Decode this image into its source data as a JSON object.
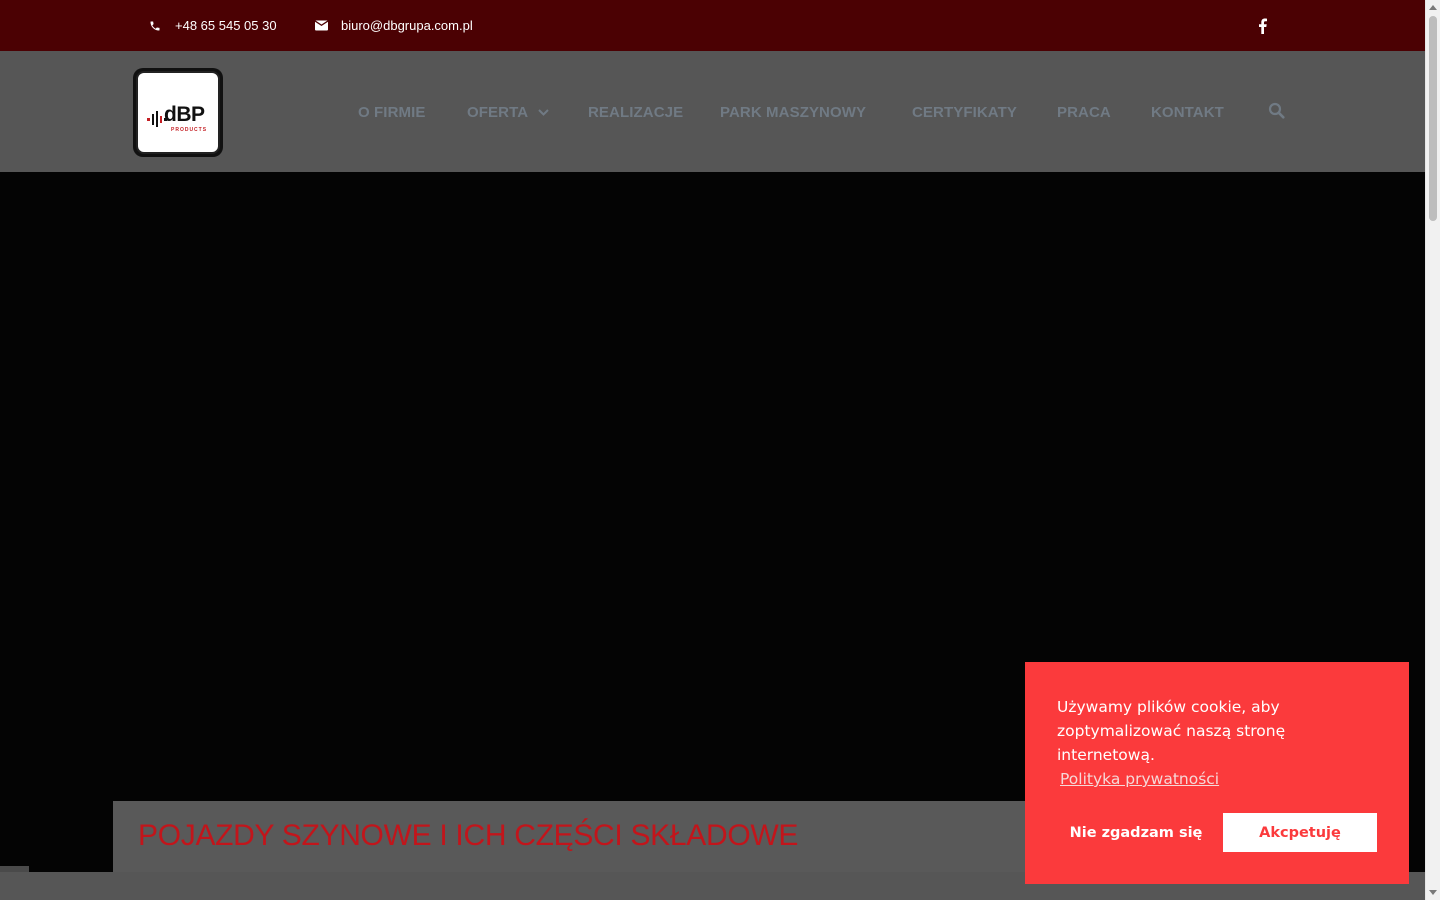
{
  "topbar": {
    "phone": "+48 65 545 05 30",
    "email": "biuro@dbgrupa.com.pl",
    "phone_icon": "phone-icon",
    "email_icon": "envelope-icon",
    "social_icon": "facebook-icon"
  },
  "header": {
    "logo_text": "dBP",
    "logo_subtext": "PRODUCTS"
  },
  "nav": {
    "items": [
      {
        "label": "O FIRMIE"
      },
      {
        "label": "OFERTA"
      },
      {
        "label": "REALIZACJE"
      },
      {
        "label": "PARK MASZYNOWY"
      },
      {
        "label": "CERTYFIKATY"
      },
      {
        "label": "PRACA"
      },
      {
        "label": "KONTAKT"
      }
    ],
    "search_icon": "search-icon"
  },
  "hero": {
    "caption": "POJAZDY SZYNOWE I ICH CZĘŚCI SKŁADOWE"
  },
  "cookie": {
    "message": "Używamy plików cookie, aby zoptymalizować naszą stronę internetową.",
    "link": "Polityka prywatności",
    "decline": "Nie zgadzam się",
    "accept": "Akcpetuję"
  },
  "colors": {
    "topbar_bg": "#4b0103",
    "header_bg": "#565656",
    "nav_text": "#707a84",
    "caption_text": "#c2151b",
    "cookie_bg": "#fb3a3c"
  }
}
